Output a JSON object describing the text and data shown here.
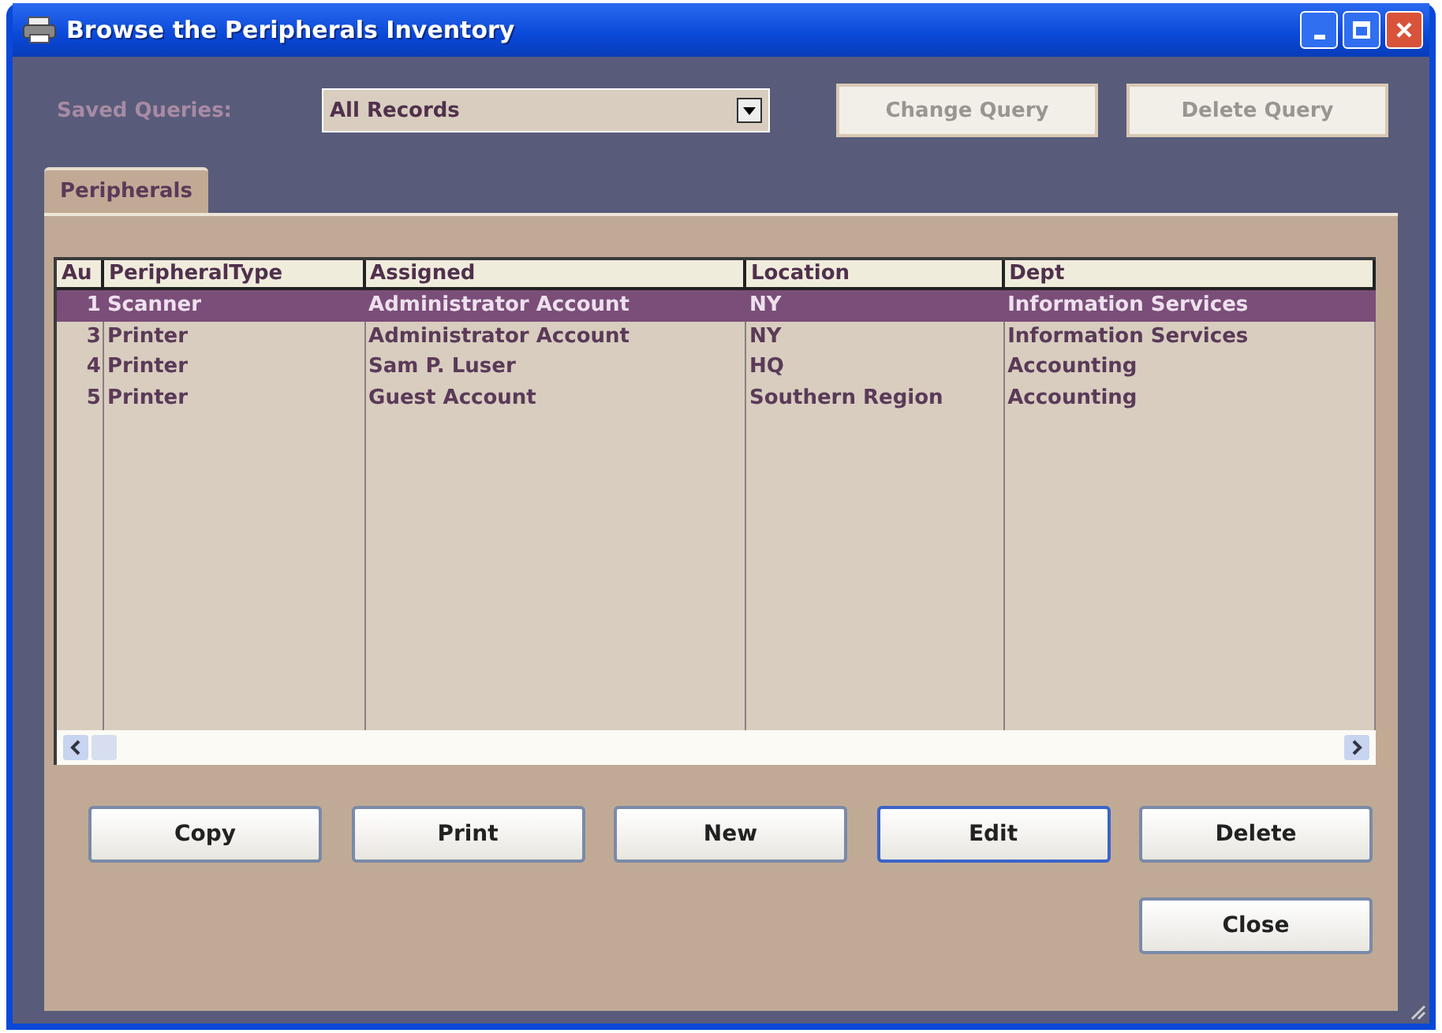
{
  "window": {
    "title": "Browse the Peripherals Inventory"
  },
  "saved_queries": {
    "label": "Saved Queries:",
    "value": "All Records",
    "disabled": true
  },
  "query_buttons": [
    {
      "label": "Change Query",
      "disabled": true
    },
    {
      "label": "Delete Query",
      "disabled": true
    }
  ],
  "tabs": [
    {
      "label": "Peripherals",
      "selected": true
    }
  ],
  "table": {
    "columns": [
      "Au",
      "PeripheralType",
      "Assigned",
      "Location",
      "Dept"
    ],
    "rows": [
      {
        "cells": [
          "1",
          "Scanner",
          "Administrator Account",
          "NY",
          "Information Services"
        ],
        "selected": true
      },
      {
        "cells": [
          "3",
          "Printer",
          "Administrator Account",
          "NY",
          "Information Services"
        ],
        "selected": false
      },
      {
        "cells": [
          "4",
          "Printer",
          "Sam P. Luser",
          "HQ",
          "Accounting"
        ],
        "selected": false
      },
      {
        "cells": [
          "5",
          "Printer",
          "Guest Account",
          "Southern Region",
          "Accounting"
        ],
        "selected": false
      }
    ]
  },
  "buttons": [
    {
      "label": "Copy",
      "default": false
    },
    {
      "label": "Print",
      "default": false
    },
    {
      "label": "New",
      "default": false
    },
    {
      "label": "Edit",
      "default": true
    },
    {
      "label": "Delete",
      "default": false
    }
  ],
  "close_button": {
    "label": "Close"
  }
}
